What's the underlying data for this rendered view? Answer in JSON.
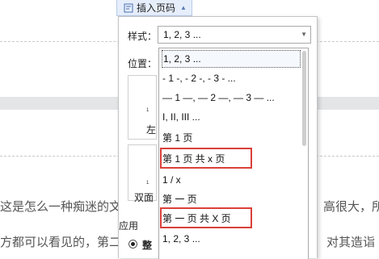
{
  "toolbar": {
    "insert_page_number_label": "插入页码"
  },
  "document": {
    "line1_left": "这是怎么一种痴迷的文",
    "line1_right": "高很大，所",
    "line2_left": "方都可以看见的，第二",
    "line2_right": "对其造诣"
  },
  "panel": {
    "style_label": "样式：",
    "style_selected": "1, 2, 3 ...",
    "position_label": "位置：",
    "left_label": "左",
    "double_label": "双面",
    "apply_label": "应用",
    "apply_option": "整",
    "style_options": [
      "1, 2, 3 ...",
      "- 1 -, - 2 -, - 3 - ...",
      "— 1 —, — 2 —, — 3 — ...",
      "I, II, III ...",
      "第 1 页",
      "第 1 页 共 x 页",
      "1 / x",
      "第 一 页",
      "第 一 页 共 X 页",
      "1, 2, 3 ..."
    ]
  },
  "colors": {
    "highlight_box": "#d9403a",
    "toolbar_bg": "#e6eefc"
  }
}
